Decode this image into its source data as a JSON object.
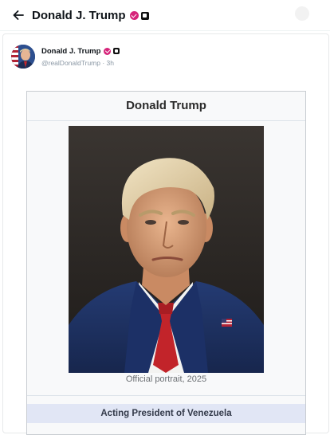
{
  "header": {
    "back_icon": "arrow-left-icon",
    "title": "Donald J. Trump",
    "verified_badge_color": "#d6247a",
    "affiliation_badge_color": "#111111"
  },
  "post": {
    "author": {
      "name": "Donald J. Trump",
      "handle_time": "@realDonaldTrump · 3h"
    },
    "infobox": {
      "title": "Donald Trump",
      "image_caption": "Official portrait, 2025",
      "office": "Acting President of Venezuela",
      "office_band_color": "#e1e6f5"
    }
  }
}
